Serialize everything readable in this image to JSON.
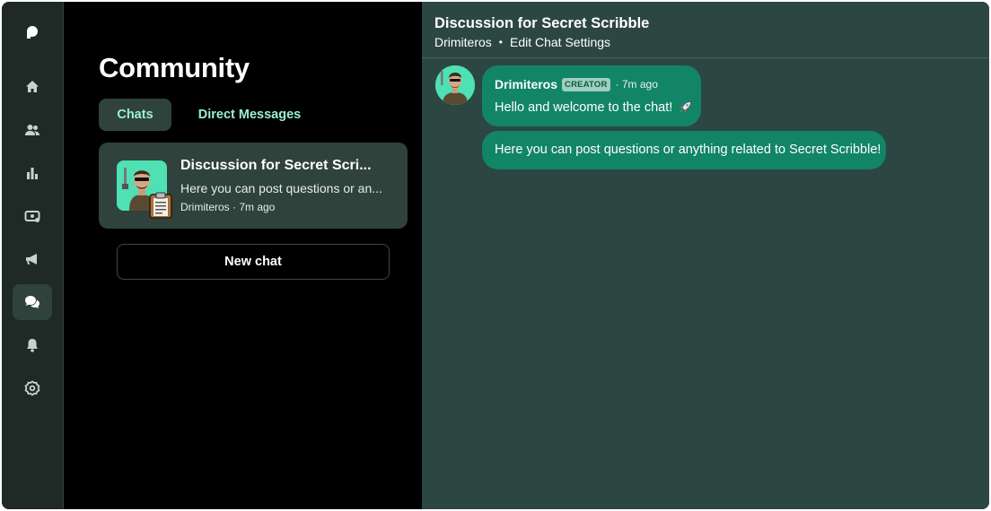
{
  "sidebar": {
    "items": [
      {
        "icon": "home-icon"
      },
      {
        "icon": "members-icon"
      },
      {
        "icon": "analytics-icon"
      },
      {
        "icon": "payouts-icon"
      },
      {
        "icon": "promotions-icon"
      },
      {
        "icon": "chat-icon",
        "active": true
      },
      {
        "icon": "notifications-icon"
      },
      {
        "icon": "settings-icon"
      }
    ]
  },
  "community": {
    "title": "Community",
    "tabs": [
      "Chats",
      "Direct Messages"
    ],
    "selected_tab": "Chats",
    "chat_card": {
      "title": "Discussion for Secret Scri...",
      "preview": "Here you can post questions or an...",
      "meta": "Drimiteros · 7m ago"
    },
    "new_chat_label": "New chat"
  },
  "chat": {
    "title": "Discussion for Secret Scribble",
    "owner": "Drimiteros",
    "separator": "•",
    "settings_link": "Edit Chat Settings",
    "messages": [
      {
        "author": "Drimiteros",
        "badge": "CREATOR",
        "time": "· 7m ago",
        "text": "Hello and welcome to the chat!"
      },
      {
        "text": "Here you can post questions or anything related to Secret Scribble!"
      }
    ]
  },
  "colors": {
    "rail_bg": "#1f2a26",
    "accent_text": "#9af0cf",
    "card_bg": "#2f423b",
    "chat_bg": "#2c4741",
    "bubble_bg": "#128566"
  }
}
